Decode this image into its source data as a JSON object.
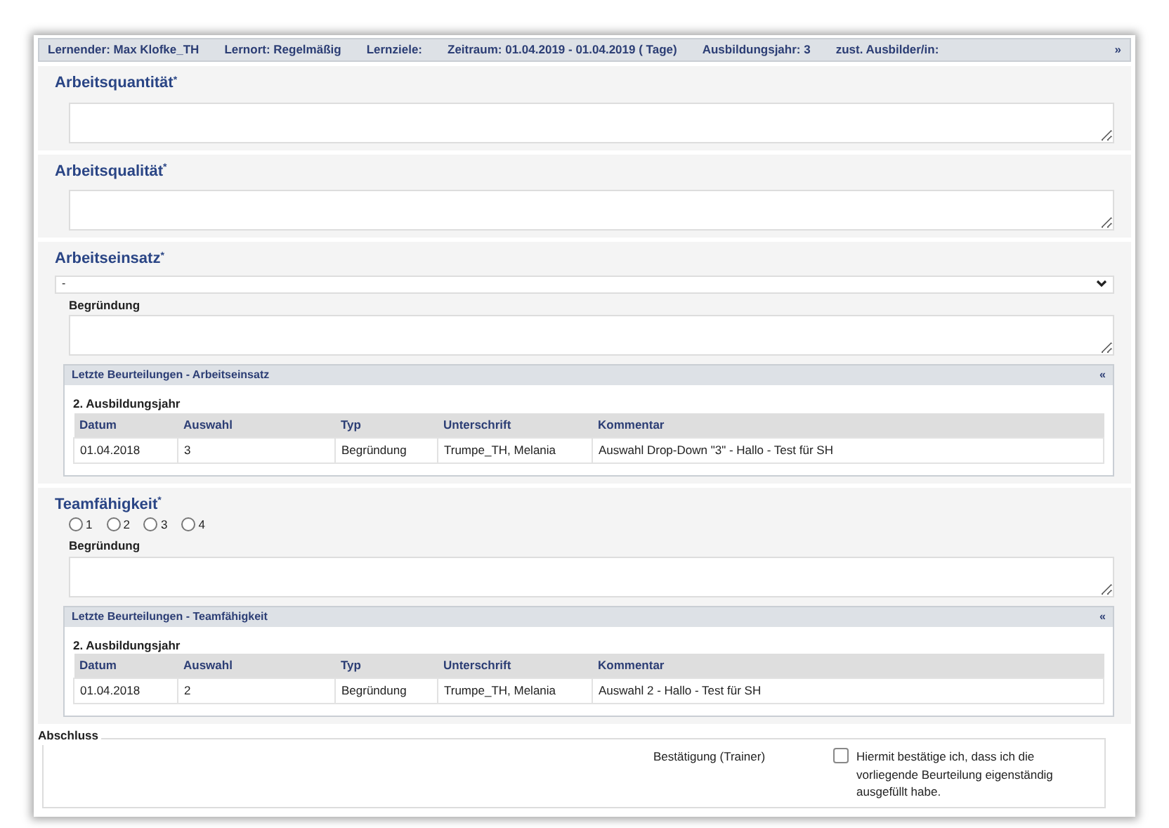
{
  "header": {
    "items": [
      "Lernender: Max Klofke_TH",
      "Lernort: Regelmäßig",
      "Lernziele:",
      "Zeitraum: 01.04.2019 - 01.04.2019 ( Tage)",
      "Ausbildungsjahr: 3",
      "zust. Ausbilder/in:"
    ],
    "toggle": "»"
  },
  "sections": [
    {
      "kind": "text",
      "title": "Arbeitsquantität",
      "required": "*"
    },
    {
      "kind": "text",
      "title": "Arbeitsqualität",
      "required": "*"
    },
    {
      "kind": "select",
      "title": "Arbeitseinsatz",
      "required": "*",
      "value": "-",
      "reason_label": "Begründung",
      "history": {
        "title": "Letzte Beurteilungen - Arbeitseinsatz",
        "toggle": "«",
        "year": "2. Ausbildungsjahr",
        "columns": [
          "Datum",
          "Auswahl",
          "Typ",
          "Unterschrift",
          "Kommentar"
        ],
        "rows": [
          [
            "01.04.2018",
            "3",
            "Begründung",
            "Trumpe_TH, Melania",
            "Auswahl Drop-Down \"3\" - Hallo - Test für SH"
          ]
        ]
      }
    },
    {
      "kind": "radio",
      "title": "Teamfähigkeit",
      "required": "*",
      "options": [
        {
          "label": "1",
          "selected": false
        },
        {
          "label": "2",
          "selected": false
        },
        {
          "label": "3",
          "selected": false
        },
        {
          "label": "4",
          "selected": false
        }
      ],
      "reason_label": "Begründung",
      "history": {
        "title": "Letzte Beurteilungen - Teamfähigkeit",
        "toggle": "«",
        "year": "2. Ausbildungsjahr",
        "columns": [
          "Datum",
          "Auswahl",
          "Typ",
          "Unterschrift",
          "Kommentar"
        ],
        "rows": [
          [
            "01.04.2018",
            "2",
            "Begründung",
            "Trumpe_TH, Melania",
            "Auswahl 2 - Hallo - Test für SH"
          ]
        ]
      }
    }
  ],
  "closing": {
    "title": "Abschluss",
    "label": "Bestätigung (Trainer)",
    "checkbox": {
      "checked": false,
      "label": "Hiermit bestätige ich, dass ich die vorliegende Beurteilung eigenständig ausgefüllt habe."
    }
  }
}
